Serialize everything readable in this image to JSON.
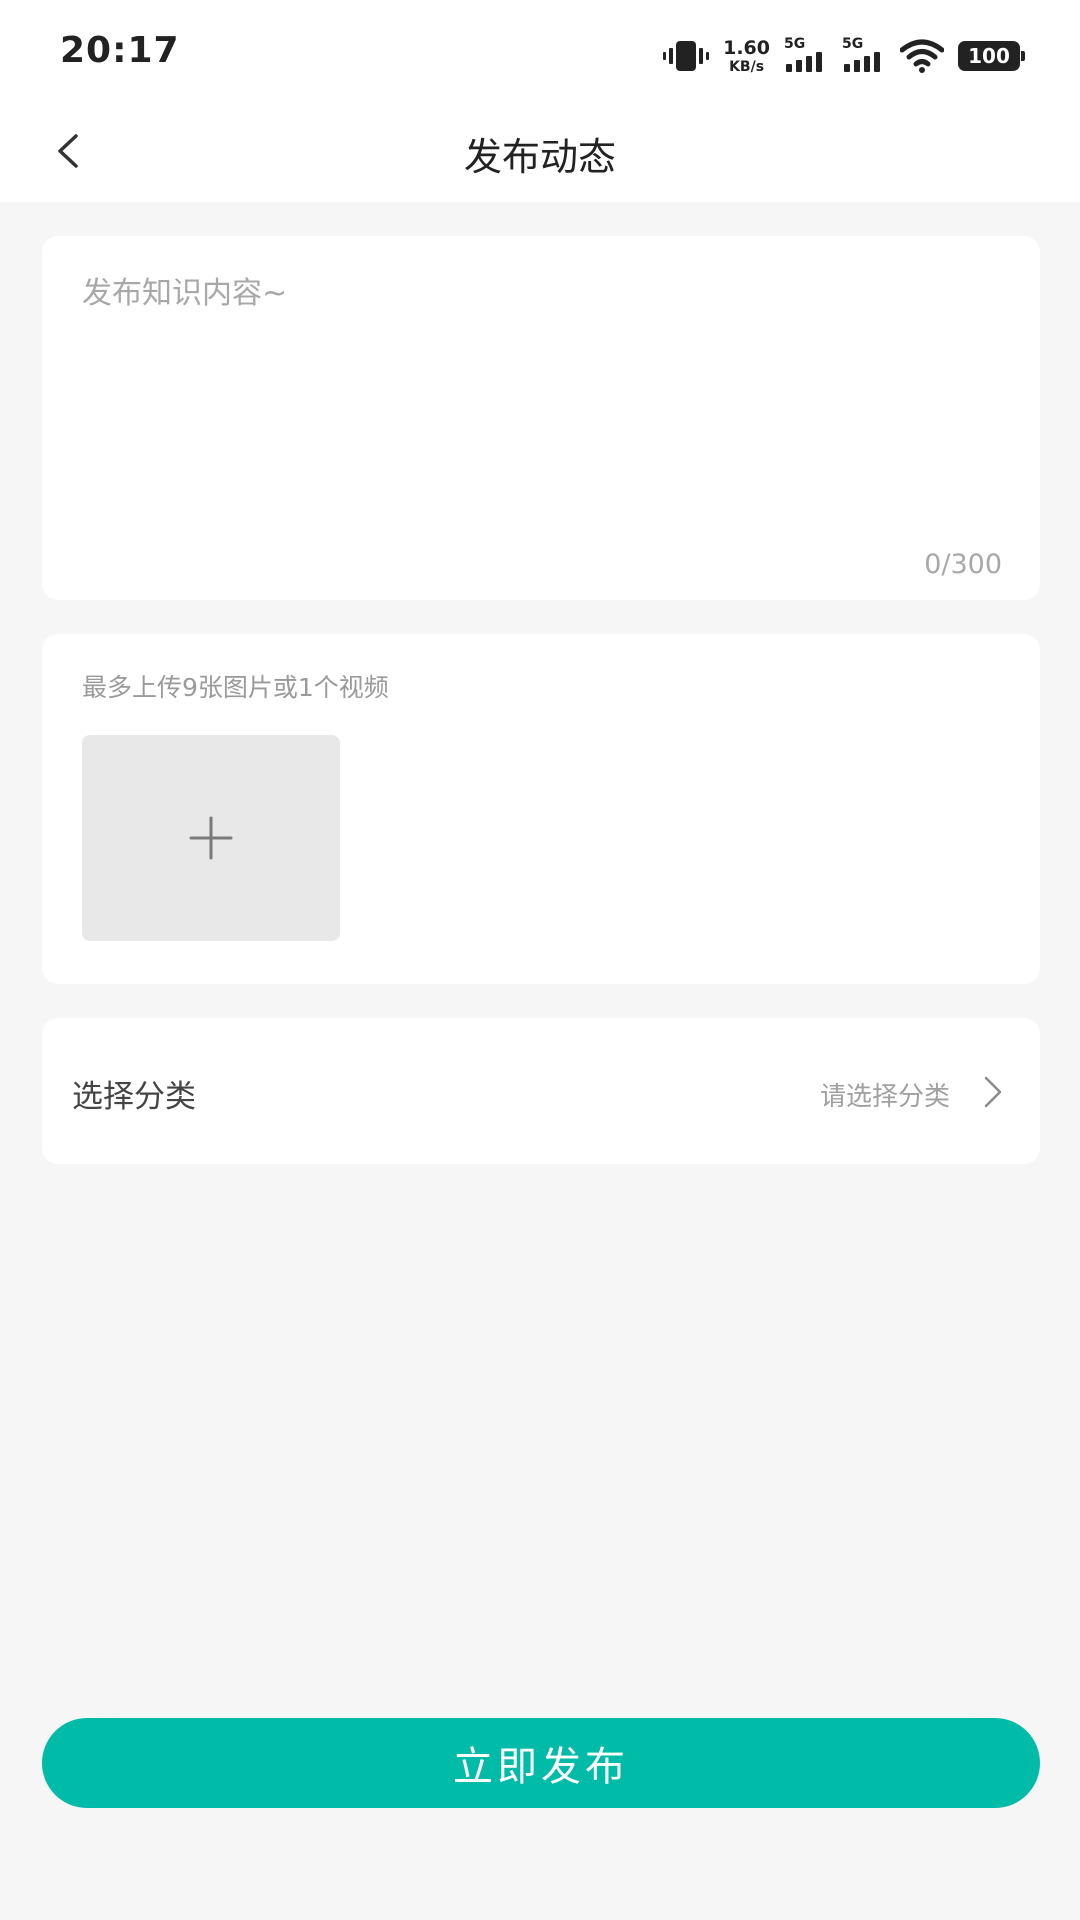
{
  "status_bar": {
    "time": "20:17",
    "net_speed_value": "1.60",
    "net_speed_unit": "KB/s",
    "signal_1_label": "5G",
    "signal_2_label": "5G",
    "battery_level": "100",
    "icons": [
      "vibrate-icon",
      "signal-icon",
      "signal-icon",
      "wifi-icon",
      "battery-icon"
    ]
  },
  "header": {
    "back_icon": "chevron-left-icon",
    "title": "发布动态"
  },
  "content_editor": {
    "value": "",
    "placeholder": "发布知识内容~",
    "char_count": "0/300"
  },
  "media_upload": {
    "hint": "最多上传9张图片或1个视频",
    "add_icon": "plus-icon"
  },
  "category": {
    "label": "选择分类",
    "placeholder": "请选择分类",
    "arrow_icon": "chevron-right-icon"
  },
  "publish_button": {
    "label": "立即发布"
  },
  "colors": {
    "accent": "#00bba8",
    "background": "#f6f6f6",
    "card": "#ffffff",
    "upload_tile": "#e8e8e8",
    "placeholder_text": "#a8a8a8"
  }
}
